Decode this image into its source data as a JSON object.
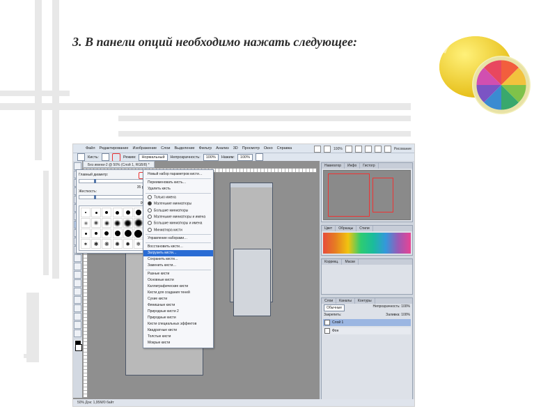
{
  "heading": "3. В панели опций необходимо нажать следующее:",
  "ps": {
    "menu": [
      "Файл",
      "Редактирование",
      "Изображение",
      "Слои",
      "Выделение",
      "Фильтр",
      "Анализ",
      "3D",
      "Просмотр",
      "Окно",
      "Справка"
    ],
    "workspace_label": "Рисование",
    "zoom_field": "100%",
    "options": {
      "brush_label": "Кисть:",
      "mode_label": "Режим:",
      "mode_value": "Нормальный",
      "opacity_label": "Непрозрачность:",
      "opacity_value": "100%",
      "flow_label": "Нажим:",
      "flow_value": "100%"
    },
    "doc_tab": "Без имени-2 @ 50% (Слой 1, RGB/8) *",
    "brush_panel": {
      "diameter_label": "Главный диаметр:",
      "diameter_value": "35 px",
      "hardness_label": "Жесткость:",
      "hardness_value": "0%"
    },
    "context_menu": {
      "group1": [
        "Новый набор параметров кисти…"
      ],
      "group2": [
        "Переименовать кисть…",
        "Удалить кисть"
      ],
      "group3": [
        "Только имена",
        "Маленькие миниатюры",
        "Большие миниатюры",
        "Маленькие миниатюры и имена",
        "Большие миниатюры и имена",
        "Миниатюра кисти"
      ],
      "selected_view": "Маленькие миниатюры",
      "group4": [
        "Управление наборами…"
      ],
      "group5": [
        "Восстановить кисти…",
        "Загрузить кисти…",
        "Сохранить кисти…",
        "Заменить кисти…"
      ],
      "highlight": "Загрузить кисти…",
      "group6": [
        "Разные кисти",
        "Основные кисти",
        "Каллиграфические кисти",
        "Кисти для создания теней",
        "Сухие кисти",
        "Финишные кисти",
        "Природные кисти 2",
        "Природные кисти",
        "Кисти специальных эффектов",
        "Квадратные кисти",
        "Толстые кисти",
        "Мокрые кисти"
      ]
    },
    "right_panels": {
      "navigator_tabs": [
        "Навигатор",
        "Инфо",
        "Гистогр"
      ],
      "swatches_tabs": [
        "Цвет",
        "Образцы",
        "Стили"
      ],
      "adjust_tabs": [
        "Коррекц.",
        "Маски"
      ],
      "layers_tabs": [
        "Слои",
        "Каналы",
        "Контуры"
      ],
      "layers_mode": "Обычные",
      "layers_opacity_label": "Непрозрачность:",
      "layers_opacity_value": "100%",
      "layers_lock_label": "Закрепить:",
      "layers_fill_label": "Заливка:",
      "layers_fill_value": "100%",
      "layers": [
        {
          "name": "Слой 1"
        },
        {
          "name": "Фон"
        }
      ]
    },
    "status": "50%    Док: 1,95M/0 байт"
  }
}
